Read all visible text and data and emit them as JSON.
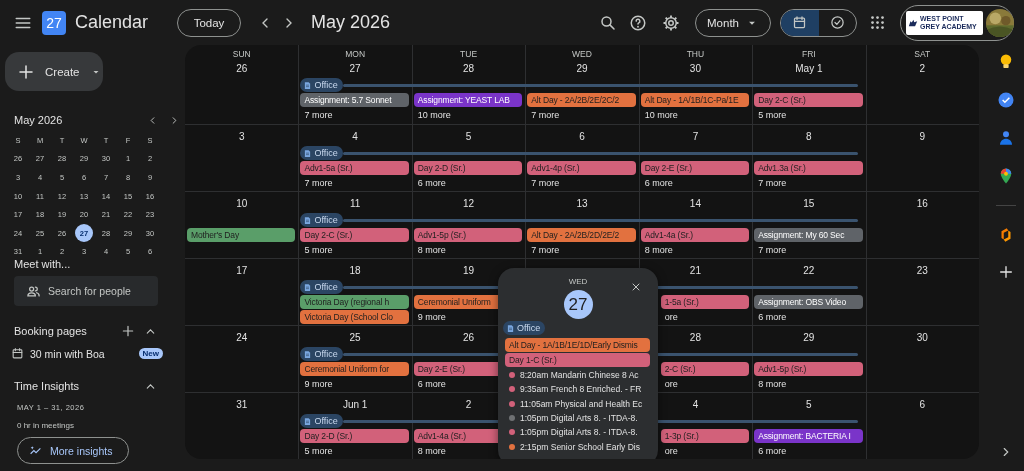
{
  "header": {
    "app_name": "Calendar",
    "logo_day": "27",
    "today_button": "Today",
    "period_title": "May 2026",
    "view_menu": "Month",
    "view_toggle": [
      {
        "kind": "calendar",
        "selected": true
      },
      {
        "kind": "tasks",
        "selected": false
      }
    ],
    "account": {
      "org_name": "WEST POINT GREY ACADEMY"
    }
  },
  "sidebar": {
    "create_label": "Create",
    "mini_calendar": {
      "title": "May 2026",
      "weekdays": [
        "S",
        "M",
        "T",
        "W",
        "T",
        "F",
        "S"
      ],
      "weeks": [
        [
          {
            "day": "26",
            "selected": false
          },
          {
            "day": "27",
            "selected": false
          },
          {
            "day": "28",
            "selected": false
          },
          {
            "day": "29",
            "selected": false
          },
          {
            "day": "30",
            "selected": false
          },
          {
            "day": "1",
            "selected": false
          },
          {
            "day": "2",
            "selected": false
          }
        ],
        [
          {
            "day": "3",
            "selected": false
          },
          {
            "day": "4",
            "selected": false
          },
          {
            "day": "5",
            "selected": false
          },
          {
            "day": "6",
            "selected": false
          },
          {
            "day": "7",
            "selected": false
          },
          {
            "day": "8",
            "selected": false
          },
          {
            "day": "9",
            "selected": false
          }
        ],
        [
          {
            "day": "10",
            "selected": false
          },
          {
            "day": "11",
            "selected": false
          },
          {
            "day": "12",
            "selected": false
          },
          {
            "day": "13",
            "selected": false
          },
          {
            "day": "14",
            "selected": false
          },
          {
            "day": "15",
            "selected": false
          },
          {
            "day": "16",
            "selected": false
          }
        ],
        [
          {
            "day": "17",
            "selected": false
          },
          {
            "day": "18",
            "selected": false
          },
          {
            "day": "19",
            "selected": false
          },
          {
            "day": "20",
            "selected": false
          },
          {
            "day": "21",
            "selected": false
          },
          {
            "day": "22",
            "selected": false
          },
          {
            "day": "23",
            "selected": false
          }
        ],
        [
          {
            "day": "24",
            "selected": false
          },
          {
            "day": "25",
            "selected": false
          },
          {
            "day": "26",
            "selected": false
          },
          {
            "day": "27",
            "selected": true
          },
          {
            "day": "28",
            "selected": false
          },
          {
            "day": "29",
            "selected": false
          },
          {
            "day": "30",
            "selected": false
          }
        ],
        [
          {
            "day": "31",
            "selected": false
          },
          {
            "day": "1",
            "selected": false
          },
          {
            "day": "2",
            "selected": false
          },
          {
            "day": "3",
            "selected": false
          },
          {
            "day": "4",
            "selected": false
          },
          {
            "day": "5",
            "selected": false
          },
          {
            "day": "6",
            "selected": false
          }
        ]
      ]
    },
    "meet_with": {
      "heading": "Meet with...",
      "placeholder": "Search for people"
    },
    "booking_pages": {
      "heading": "Booking pages",
      "items": [
        {
          "label": "30 min with Boa",
          "badge": "New"
        }
      ]
    },
    "time_insights": {
      "heading": "Time Insights",
      "range": "MAY 1 – 31, 2026",
      "summary": "0 hr in meetings",
      "button": "More insights"
    }
  },
  "month": {
    "weekdays": [
      "SUN",
      "MON",
      "TUE",
      "WED",
      "THU",
      "FRI",
      "SAT"
    ],
    "weeks": [
      {
        "office": "Office",
        "days": [
          {
            "kind": "day",
            "date": "26"
          },
          {
            "kind": "day",
            "date": "27",
            "chips": [
              {
                "text": "Assignment: 5.7 Sonnet",
                "color": "#5f6368"
              }
            ],
            "more": "7 more"
          },
          {
            "kind": "day",
            "date": "28",
            "chips": [
              {
                "text": "Assignment: YEAST LAB",
                "color": "#7a34c9"
              }
            ],
            "more": "10 more"
          },
          {
            "kind": "day",
            "date": "29",
            "chips": [
              {
                "text": "Alt Day - 2A/2B/2E/2C/2",
                "color": "#e2713f"
              }
            ],
            "more": "7 more"
          },
          {
            "kind": "day",
            "date": "30",
            "chips": [
              {
                "text": "Alt Day - 1A/1B/1C-Pa/1E",
                "color": "#e2713f"
              }
            ],
            "more": "10 more"
          },
          {
            "kind": "day",
            "date": "May 1",
            "chips": [
              {
                "text": "Day 2-C (Sr.)",
                "color": "#d2617a"
              }
            ],
            "more": "5 more"
          },
          {
            "kind": "day",
            "date": "2"
          }
        ]
      },
      {
        "office": "Office",
        "days": [
          {
            "kind": "day",
            "date": "3"
          },
          {
            "kind": "day",
            "date": "4",
            "chips": [
              {
                "text": "Adv1-5a (Sr.)",
                "color": "#d2617a"
              }
            ],
            "more": "7 more"
          },
          {
            "kind": "day",
            "date": "5",
            "chips": [
              {
                "text": "Day 2-D (Sr.)",
                "color": "#d2617a"
              }
            ],
            "more": "6 more"
          },
          {
            "kind": "day",
            "date": "6",
            "chips": [
              {
                "text": "Adv1-4p (Sr.)",
                "color": "#d2617a"
              }
            ],
            "more": "7 more"
          },
          {
            "kind": "day",
            "date": "7",
            "chips": [
              {
                "text": "Day 2-E (Sr.)",
                "color": "#d2617a"
              }
            ],
            "more": "6 more"
          },
          {
            "kind": "day",
            "date": "8",
            "chips": [
              {
                "text": "Adv1.3a (Sr.)",
                "color": "#d2617a"
              }
            ],
            "more": "7 more"
          },
          {
            "kind": "day",
            "date": "9"
          }
        ]
      },
      {
        "office": "Office",
        "days": [
          {
            "kind": "day",
            "date": "10",
            "chips": [
              {
                "text": "Mother's Day",
                "color": "#5a9e69"
              }
            ]
          },
          {
            "kind": "day",
            "date": "11",
            "chips": [
              {
                "text": "Day 2-C (Sr.)",
                "color": "#d2617a"
              }
            ],
            "more": "5 more"
          },
          {
            "kind": "day",
            "date": "12",
            "chips": [
              {
                "text": "Adv1-5p (Sr.)",
                "color": "#d2617a"
              }
            ],
            "more": "8 more"
          },
          {
            "kind": "day",
            "date": "13",
            "chips": [
              {
                "text": "Alt Day - 2A/2B/2D/2E/2",
                "color": "#e2713f"
              }
            ],
            "more": "7 more"
          },
          {
            "kind": "day",
            "date": "14",
            "chips": [
              {
                "text": "Adv1-4a (Sr.)",
                "color": "#d2617a"
              }
            ],
            "more": "8 more"
          },
          {
            "kind": "day",
            "date": "15",
            "chips": [
              {
                "text": "Assignment: My 60 Sec",
                "color": "#5f6368"
              }
            ],
            "more": "7 more"
          },
          {
            "kind": "day",
            "date": "16"
          }
        ]
      },
      {
        "office": "Office",
        "days": [
          {
            "kind": "day",
            "date": "17"
          },
          {
            "kind": "day",
            "date": "18",
            "chips": [
              {
                "text": "Victoria Day (regional h",
                "color": "#5a9e69"
              },
              {
                "text": "Victoria Day (School Clo",
                "color": "#e2713f"
              }
            ]
          },
          {
            "kind": "day",
            "date": "19",
            "chips": [
              {
                "text": "Ceremonial Uniform",
                "color": "#e2713f"
              }
            ],
            "more": "9 more"
          },
          {
            "kind": "covered"
          },
          {
            "kind": "day",
            "date": "21",
            "chips": [
              {
                "text": "1-5a (Sr.)",
                "color": "#d2617a"
              }
            ],
            "more": "ore"
          },
          {
            "kind": "day",
            "date": "22",
            "chips": [
              {
                "text": "Assignment: OBS Video",
                "color": "#5f6368"
              }
            ],
            "more": "6 more"
          },
          {
            "kind": "day",
            "date": "23"
          }
        ]
      },
      {
        "office": "Office",
        "days": [
          {
            "kind": "day",
            "date": "24"
          },
          {
            "kind": "day",
            "date": "25",
            "chips": [
              {
                "text": "Ceremonial Uniform for",
                "color": "#e2713f"
              }
            ],
            "more": "9 more"
          },
          {
            "kind": "day",
            "date": "26",
            "chips": [
              {
                "text": "Day 2-E (Sr.)",
                "color": "#d2617a"
              }
            ],
            "more": "6 more"
          },
          {
            "kind": "covered"
          },
          {
            "kind": "day",
            "date": "28",
            "chips": [
              {
                "text": "2-C (Sr.)",
                "color": "#d2617a"
              }
            ],
            "more": "ore"
          },
          {
            "kind": "day",
            "date": "29",
            "chips": [
              {
                "text": "Adv1-5p (Sr.)",
                "color": "#d2617a"
              }
            ],
            "more": "8 more"
          },
          {
            "kind": "day",
            "date": "30"
          }
        ]
      },
      {
        "office": "Office",
        "days": [
          {
            "kind": "day",
            "date": "31"
          },
          {
            "kind": "day",
            "date": "Jun 1",
            "chips": [
              {
                "text": "Day 2-D (Sr.)",
                "color": "#d2617a"
              }
            ],
            "more": "5 more"
          },
          {
            "kind": "day",
            "date": "2",
            "chips": [
              {
                "text": "Adv1-4a (Sr.)",
                "color": "#d2617a"
              }
            ],
            "more": "8 more"
          },
          {
            "kind": "covered"
          },
          {
            "kind": "day",
            "date": "4",
            "chips": [
              {
                "text": "1-3p (Sr.)",
                "color": "#d2617a"
              }
            ],
            "more": "ore"
          },
          {
            "kind": "day",
            "date": "5",
            "chips": [
              {
                "text": "Assignment: BACTERIA I",
                "color": "#7a34c9"
              }
            ],
            "more": "6 more"
          },
          {
            "kind": "day",
            "date": "6"
          }
        ]
      }
    ]
  },
  "popup": {
    "weekday": "WED",
    "date": "27",
    "office": "Office",
    "chips": [
      {
        "text": "Alt Day - 1A/1B/1E/1D/Early Dismis",
        "color": "#e2713f"
      },
      {
        "text": "Day 1-C (Sr.)",
        "color": "#d2617a"
      }
    ],
    "events": [
      {
        "text": "8:20am Mandarin Chinese 8 Ac",
        "color": "#d2617a"
      },
      {
        "text": "9:35am French 8 Enriched. - FR",
        "color": "#d2617a"
      },
      {
        "text": "11:05am Physical and Health Ec",
        "color": "#d2617a"
      },
      {
        "text": "1:05pm Digital Arts 8. - ITDA-8.",
        "color": "#6f7173"
      },
      {
        "text": "1:05pm Digital Arts 8. - ITDA-8.",
        "color": "#d2617a"
      },
      {
        "text": "2:15pm Senior School Early Dis",
        "color": "#e2713f"
      }
    ]
  }
}
